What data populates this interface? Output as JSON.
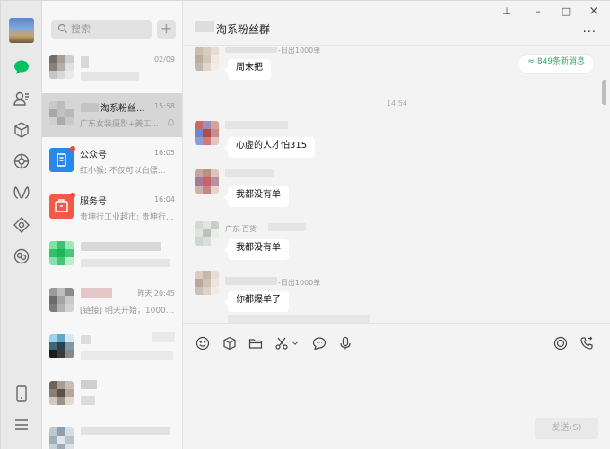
{
  "app": {
    "accent_color": "#07c160",
    "rail_icons": [
      "chat-icon",
      "contacts-icon",
      "favorites-icon",
      "moments-icon",
      "mini-programs-icon",
      "channels-icon",
      "search-cloud-icon",
      "phone-icon",
      "menu-icon"
    ]
  },
  "search": {
    "placeholder": "搜索",
    "add_label": "+"
  },
  "conversations": [
    {
      "name": "",
      "time": "02/09",
      "preview": ""
    },
    {
      "name": "淘系粉丝...",
      "time": "15:58",
      "preview": "广东女装摄影+美工..."
    },
    {
      "name": "公众号",
      "time": "16:05",
      "preview": "红小猴: 不仅可以白嫖..."
    },
    {
      "name": "服务号",
      "time": "16:04",
      "preview": "贵坤行工业超市: 贵坤行..."
    },
    {
      "name": "",
      "time": "",
      "preview": ""
    },
    {
      "name": "",
      "time": "昨天 20:45",
      "preview": "[链接] 明天开始，10000..."
    },
    {
      "name": "",
      "time": "",
      "preview": ""
    },
    {
      "name": "",
      "time": "",
      "preview": ""
    },
    {
      "name": "",
      "time": "",
      "preview": ""
    }
  ],
  "chat": {
    "title": "淘系粉丝群",
    "window_controls": {
      "pin": "⊥",
      "minimize": "–",
      "maximize": "□",
      "close": "×"
    },
    "more": "···",
    "new_messages": "849条新消息",
    "timestamp": "14:54",
    "messages": [
      {
        "sender": "-日出1000单",
        "text": "周末把"
      },
      {
        "sender": "",
        "text": "心虚的人才怕315"
      },
      {
        "sender": "",
        "text": "我都没有单"
      },
      {
        "sender": "广东-百货-",
        "text": "我都没有单"
      },
      {
        "sender": "-日出1000单",
        "text": "你都爆单了"
      }
    ]
  },
  "toolbar": {
    "icons": [
      "emoji-icon",
      "favorites-icon",
      "folder-icon",
      "screenshot-icon",
      "chat-history-icon",
      "voice-icon",
      "live-icon",
      "call-icon"
    ]
  },
  "send_label": "发送(S)"
}
